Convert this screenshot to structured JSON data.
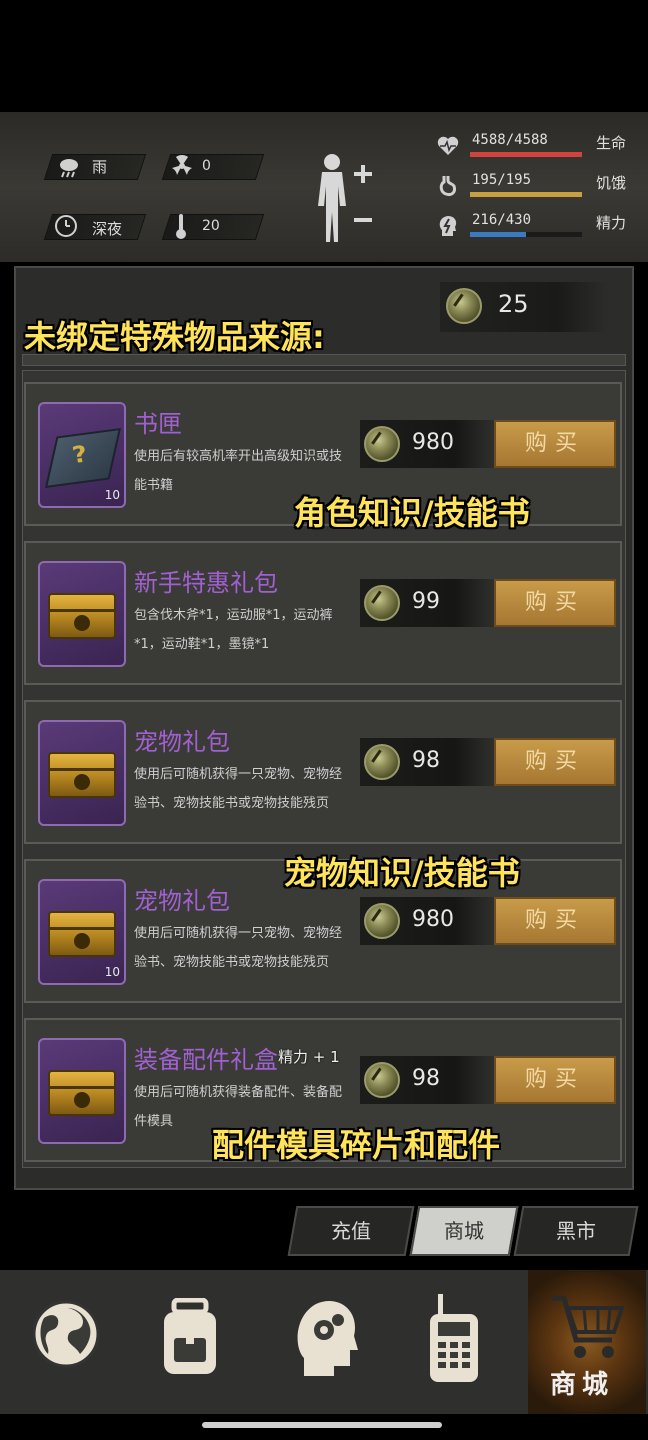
{
  "status": {
    "weather": "雨",
    "radiation": "0",
    "time_of_day": "深夜",
    "temperature": "20",
    "health": {
      "value": "4588/4588",
      "label": "生命",
      "fraction": 1.0,
      "color": "#d0443c"
    },
    "hunger": {
      "value": "195/195",
      "label": "饥饿",
      "fraction": 1.0,
      "color": "#c8a040"
    },
    "energy": {
      "value": "216/430",
      "label": "精力",
      "fraction": 0.5,
      "color": "#3a7ac0"
    }
  },
  "currency": {
    "amount": "25"
  },
  "overlays": {
    "header": "未绑定特殊物品来源:",
    "book_note": "角色知识/技能书",
    "pet_note": "宠物知识/技能书",
    "parts_note": "配件模具碎片和配件",
    "floating_energy": "精力 + 1"
  },
  "items": [
    {
      "title": "书匣",
      "desc": "使用后有较高机率开出高级知识或技能书籍",
      "qty": "10",
      "price": "980",
      "buy": "购买",
      "icon": "book-box-icon"
    },
    {
      "title": "新手特惠礼包",
      "desc": "包含伐木斧*1，运动服*1，运动裤*1，运动鞋*1，墨镜*1",
      "qty": "",
      "price": "99",
      "buy": "购买",
      "icon": "chest-icon"
    },
    {
      "title": "宠物礼包",
      "desc": "使用后可随机获得一只宠物、宠物经验书、宠物技能书或宠物技能残页",
      "qty": "",
      "price": "98",
      "buy": "购买",
      "icon": "chest-icon"
    },
    {
      "title": "宠物礼包",
      "desc": "使用后可随机获得一只宠物、宠物经验书、宠物技能书或宠物技能残页",
      "qty": "10",
      "price": "980",
      "buy": "购买",
      "icon": "chest-icon"
    },
    {
      "title": "装备配件礼盒",
      "desc": "使用后可随机获得装备配件、装备配件模具",
      "qty": "",
      "price": "98",
      "buy": "购买",
      "icon": "chest-icon"
    }
  ],
  "tabs": [
    "充值",
    "商城",
    "黑市"
  ],
  "active_tab": "商城",
  "nav": {
    "items": [
      "globe-icon",
      "backpack-icon",
      "head-gears-icon",
      "radio-icon",
      "cart-icon"
    ],
    "active_label": "商城"
  }
}
